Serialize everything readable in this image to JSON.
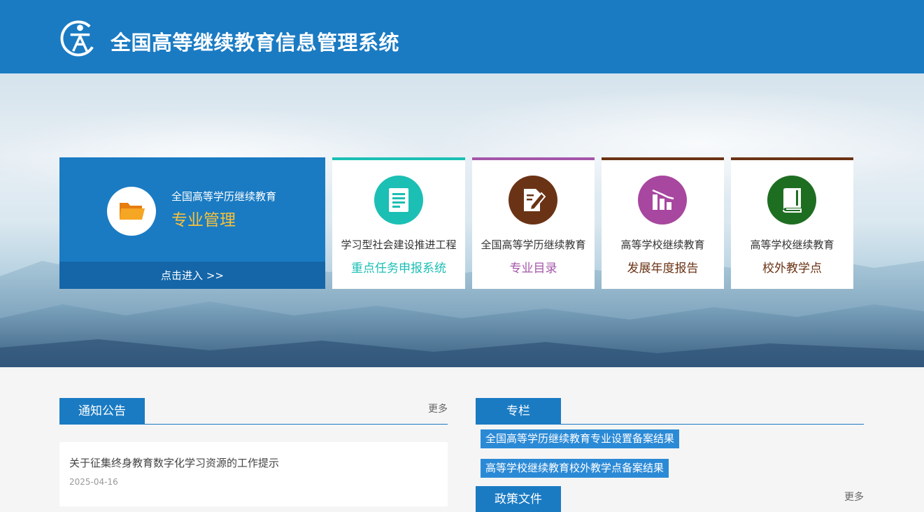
{
  "header": {
    "title": "全国高等继续教育信息管理系统",
    "brand_color": "#1a7bc3"
  },
  "main_card": {
    "subtitle": "全国高等学历继续教育",
    "title": "专业管理",
    "enter_label": "点击进入 >>",
    "icon": "folder-icon"
  },
  "cards": [
    {
      "line1": "学习型社会建设推进工程",
      "line2": "重点任务申报系统",
      "color": "#1bbfb4",
      "icon": "document-icon"
    },
    {
      "line1": "全国高等学历继续教育",
      "line2": "专业目录",
      "color": "#a456a8",
      "accent": "#6b3315",
      "icon": "edit-document-icon"
    },
    {
      "line1": "高等学校继续教育",
      "line2": "发展年度报告",
      "color": "#a8479f",
      "accent": "#6b3315",
      "icon": "bar-chart-icon"
    },
    {
      "line1": "高等学校继续教育",
      "line2": "校外教学点",
      "color": "#1e6e22",
      "accent": "#6b3315",
      "icon": "book-icon"
    }
  ],
  "notice": {
    "tab": "通知公告",
    "more": "更多",
    "items": [
      {
        "title": "关于征集终身教育数字化学习资源的工作提示",
        "date": "2025-04-16"
      }
    ]
  },
  "column": {
    "tab": "专栏",
    "links": [
      "全国高等学历继续教育专业设置备案结果",
      "高等学校继续教育校外教学点备案结果"
    ]
  },
  "policy": {
    "tab": "政策文件",
    "more": "更多"
  }
}
